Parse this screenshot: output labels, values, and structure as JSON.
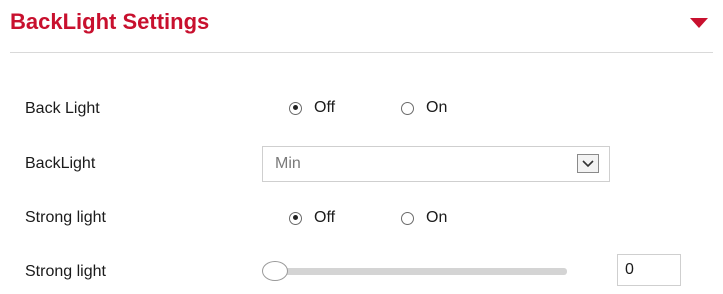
{
  "panel": {
    "title": "BackLight Settings",
    "caret_icon": "caret-down-icon",
    "accent_color": "#c8102e"
  },
  "rows": {
    "back_light": {
      "label": "Back Light",
      "options": [
        "Off",
        "On"
      ],
      "selected": "Off"
    },
    "backlight_level": {
      "label": "BackLight",
      "value": "Min",
      "icon": "chevron-down-icon"
    },
    "strong_light_mode": {
      "label": "Strong light",
      "options": [
        "Off",
        "On"
      ],
      "selected": "Off"
    },
    "strong_light_level": {
      "label": "Strong light",
      "slider_value": 0,
      "input_value": "0"
    }
  }
}
